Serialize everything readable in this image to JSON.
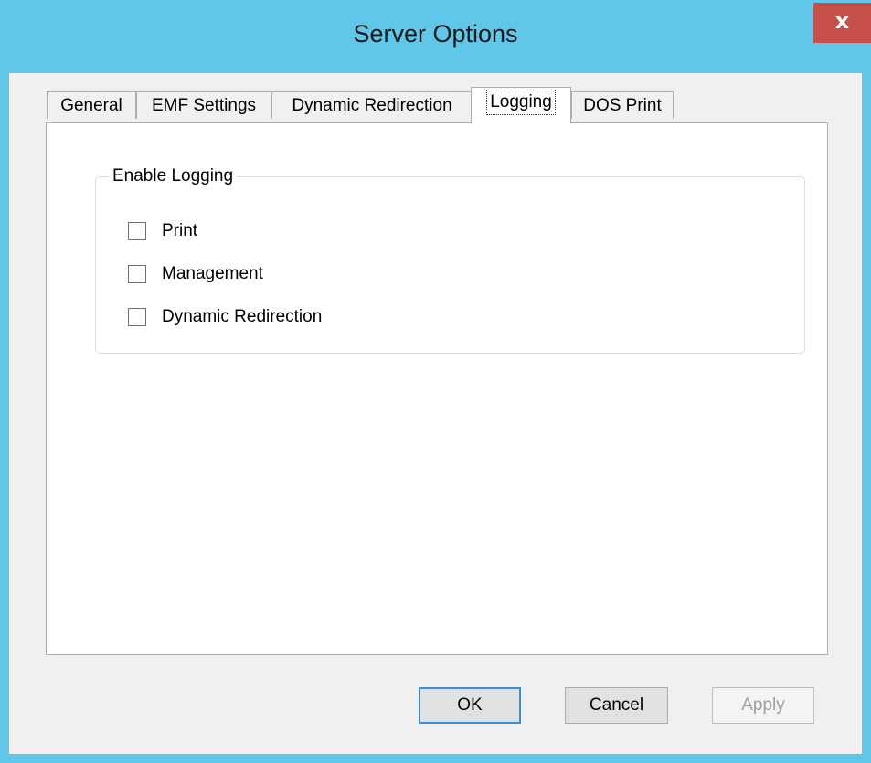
{
  "window": {
    "title": "Server Options",
    "close_label": "x"
  },
  "tabs": [
    {
      "label": "General",
      "active": false
    },
    {
      "label": "EMF Settings",
      "active": false
    },
    {
      "label": "Dynamic Redirection",
      "active": false
    },
    {
      "label": "Logging",
      "active": true
    },
    {
      "label": "DOS Print",
      "active": false
    }
  ],
  "logging": {
    "group_title": "Enable Logging",
    "options": [
      {
        "label": "Print",
        "checked": false
      },
      {
        "label": "Management",
        "checked": false
      },
      {
        "label": "Dynamic Redirection",
        "checked": false
      }
    ]
  },
  "buttons": {
    "ok": "OK",
    "cancel": "Cancel",
    "apply": "Apply"
  },
  "colors": {
    "title_bar": "#60c7e8",
    "close_button": "#c7504a",
    "default_button_border": "#3c8fd3"
  }
}
